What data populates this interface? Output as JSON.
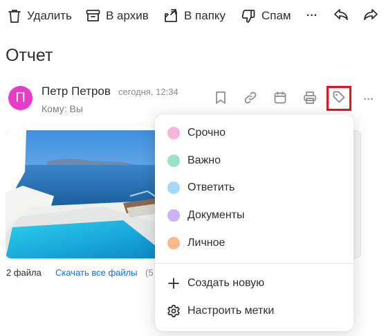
{
  "toolbar": {
    "delete_label": "Удалить",
    "archive_label": "В архив",
    "to_folder_label": "В папку",
    "spam_label": "Спам",
    "more_label": "···"
  },
  "message": {
    "subject": "Отчет",
    "avatar_letter": "П",
    "avatar_color": "#e83bc7",
    "sender": "Петр Петров",
    "time": "сегодня, 12:34",
    "recipient": "Кому: Вы",
    "more_label": "···"
  },
  "attachments": {
    "count_label": "2 файла",
    "download_all_label": "Скачать все файлы",
    "size_label": "(5"
  },
  "label_menu": {
    "items": [
      {
        "label": "Срочно",
        "color": "#f7b3d9"
      },
      {
        "label": "Важно",
        "color": "#97e3c5"
      },
      {
        "label": "Ответить",
        "color": "#a6d8fb"
      },
      {
        "label": "Документы",
        "color": "#cdb2f6"
      },
      {
        "label": "Личное",
        "color": "#f8b98c"
      }
    ],
    "create_label": "Создать новую",
    "settings_label": "Настроить метки"
  },
  "colors": {
    "highlight": "#e5141b",
    "link": "#0077ff"
  }
}
